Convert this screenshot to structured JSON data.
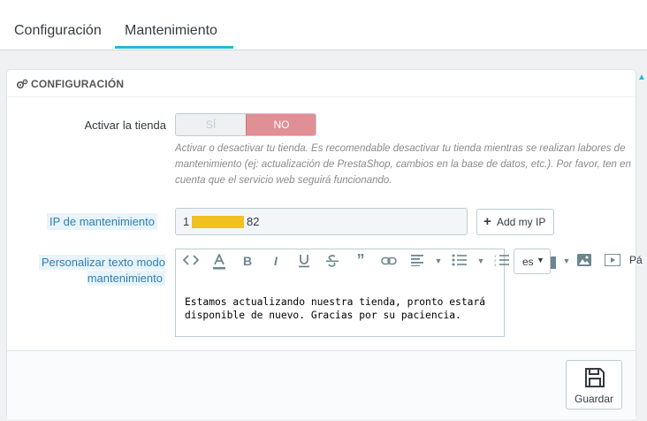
{
  "tabs": [
    {
      "label": "Configuración"
    },
    {
      "label": "Mantenimiento"
    }
  ],
  "panel": {
    "title": "CONFIGURACIÓN",
    "icon": "cogs-icon"
  },
  "shop_toggle": {
    "label": "Activar la tienda",
    "on_label": "SÍ",
    "off_label": "NO",
    "selected": "NO",
    "help": "Activar o desactivar tu tienda. Es recomendable desactivar tu tienda mientras se realizan labores de mantenimiento (ej: actualización de PrestaShop, cambios en la base de datos, etc.). Por favor, ten en cuenta que el servicio web seguirá funcionando."
  },
  "maintenance_ip": {
    "label": "IP de mantenimiento",
    "value_prefix": "1",
    "value_suffix": "82",
    "add_button": "Add my IP"
  },
  "maintenance_text": {
    "label": "Personalizar texto modo mantenimiento",
    "content": "Estamos actualizando nuestra tienda, pronto estará disponible de nuevo. Gracias por su paciencia.",
    "language": "es",
    "toolbar_partial_label": "Pá"
  },
  "footer": {
    "save_label": "Guardar"
  },
  "colors": {
    "accent": "#25b9d7",
    "switch_off": "#e08f95",
    "label_highlight": "#e8f3fa",
    "redaction": "#f2c01f"
  }
}
